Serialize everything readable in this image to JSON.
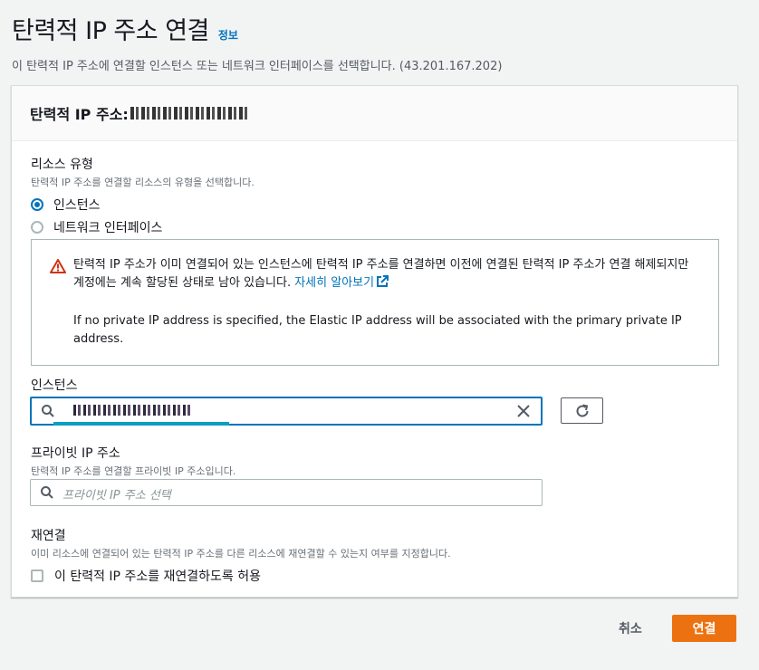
{
  "page": {
    "title": "탄력적 IP 주소 연결",
    "info_link": "정보",
    "description": "이 탄력적 IP 주소에 연결할 인스턴스 또는 네트워크 인터페이스를 선택합니다. (43.201.167.202)"
  },
  "panel": {
    "title": "탄력적 IP 주소:"
  },
  "resource_type": {
    "label": "리소스 유형",
    "description": "탄력적 IP 주소를 연결할 리소스의 유형을 선택합니다.",
    "options": [
      {
        "label": "인스턴스",
        "selected": true
      },
      {
        "label": "네트워크 인터페이스",
        "selected": false
      }
    ]
  },
  "alert": {
    "icon": "warning-icon",
    "text": "탄력적 IP 주소가 이미 연결되어 있는 인스턴스에 탄력적 IP 주소를 연결하면 이전에 연결된 탄력적 IP 주소가 연결 해제되지만 계정에는 계속 할당된 상태로 남아 있습니다.",
    "link": "자세히 알아보기",
    "note": "If no private IP address is specified, the Elastic IP address will be associated with the primary private IP address."
  },
  "instance": {
    "label": "인스턴스"
  },
  "private_ip": {
    "label": "프라이빗 IP 주소",
    "description": "탄력적 IP 주소를 연결할 프라이빗 IP 주소입니다.",
    "placeholder": "프라이빗 IP 주소 선택"
  },
  "reassociate": {
    "label": "재연결",
    "description": "이미 리소스에 연결되어 있는 탄력적 IP 주소를 다른 리소스에 재연결할 수 있는지 여부를 지정합니다.",
    "checkbox_label": "이 탄력적 IP 주소를 재연결하도록 허용",
    "checked": false
  },
  "footer": {
    "cancel": "취소",
    "submit": "연결"
  },
  "colors": {
    "accent": "#0073bb",
    "primary_button": "#ec7211",
    "warning": "#d13212"
  }
}
